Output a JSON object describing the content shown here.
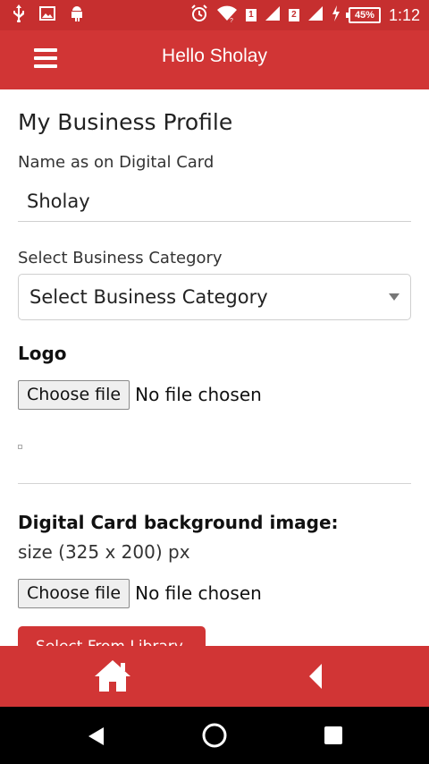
{
  "status_bar": {
    "icons_left": [
      "usb-icon",
      "image-icon",
      "android-icon"
    ],
    "icons_right": [
      "alarm-icon",
      "wifi-icon",
      "sim1-signal-icon",
      "sim2-signal-icon",
      "charging-icon"
    ],
    "sim1": "1",
    "sim2": "2",
    "battery": "45%",
    "time": "1:12"
  },
  "header": {
    "title": "Hello Sholay",
    "menu_icon": "hamburger-menu-icon"
  },
  "form": {
    "page_title": "My Business Profile",
    "name_label": "Name as on Digital Card",
    "name_value": "Sholay",
    "category_label": "Select Business Category",
    "category_selected": "Select Business Category",
    "logo_label": "Logo",
    "logo_button": "Choose file",
    "logo_status": "No file chosen",
    "bg_label": "Digital Card background image:",
    "bg_size_hint": "size (325 x 200) px",
    "bg_button": "Choose file",
    "bg_status": "No file chosen",
    "library_button": "Select From Library"
  },
  "bottom_nav": {
    "items": [
      "home-icon",
      "back-arrow-icon"
    ]
  },
  "system_nav": {
    "items": [
      "system-back-icon",
      "system-home-icon",
      "system-recents-icon"
    ]
  },
  "colors": {
    "status_bar": "#c62f2f",
    "primary": "#d13535",
    "system_nav": "#000000"
  }
}
